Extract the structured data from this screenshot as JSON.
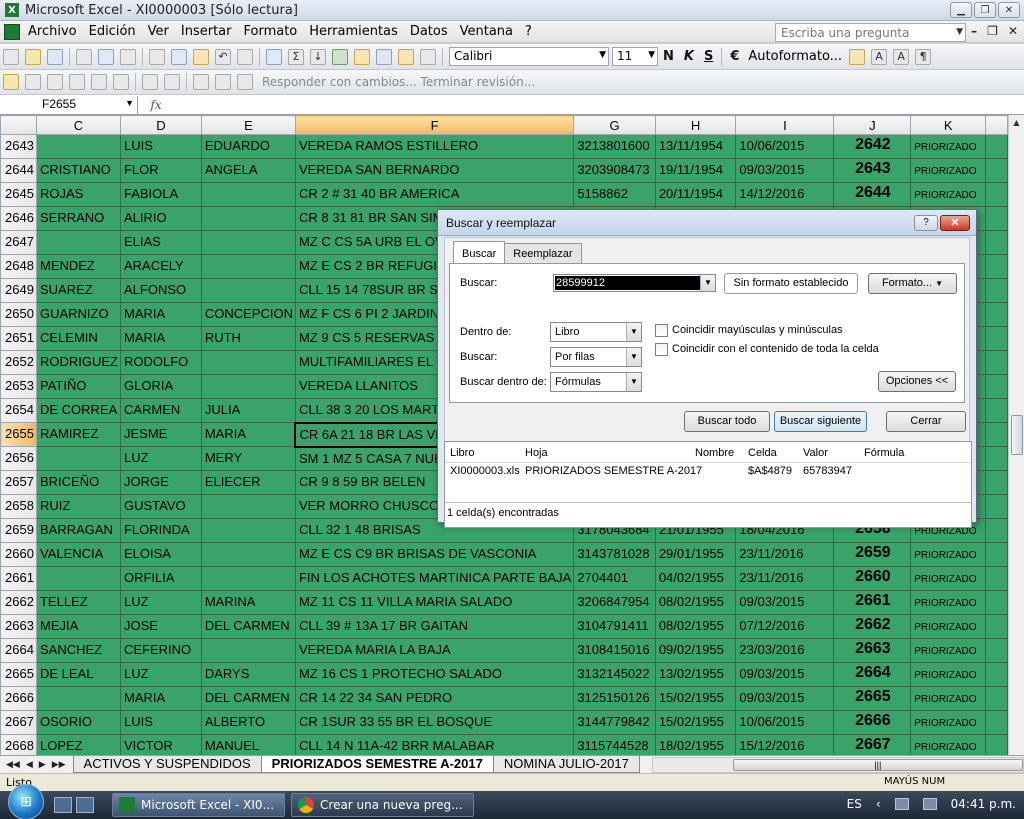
{
  "window": {
    "title": "Microsoft Excel - XI0000003  [Sólo lectura]"
  },
  "menu": {
    "items": [
      "Archivo",
      "Edición",
      "Ver",
      "Insertar",
      "Formato",
      "Herramientas",
      "Datos",
      "Ventana",
      "?"
    ],
    "ask_placeholder": "Escriba una pregunta"
  },
  "toolbar": {
    "font_name": "Calibri",
    "font_size": "11",
    "bold": "N",
    "italic": "K",
    "underline": "S",
    "currency": "€",
    "autoformat": "Autoformato...",
    "sigma": "Σ",
    "review_text": "Responder con cambios... Terminar revisión..."
  },
  "formula_bar": {
    "name_box": "F2655",
    "fx": "fx",
    "content": ""
  },
  "sheet": {
    "columns": [
      "C",
      "D",
      "E",
      "F",
      "G",
      "H",
      "I",
      "J",
      "K"
    ],
    "selected_column": "F",
    "selected_row": "2655",
    "rows": [
      {
        "n": "2643",
        "c": "",
        "d": "LUIS",
        "e": "EDUARDO",
        "f": "VEREDA RAMOS ESTILLERO",
        "g": "3213801600",
        "h": "13/11/1954",
        "i": "10/06/2015",
        "j": "2642",
        "k": "PRIORIZADO"
      },
      {
        "n": "2644",
        "c": "CRISTIANO",
        "d": "FLOR",
        "e": "ANGELA",
        "f": "VEREDA SAN BERNARDO",
        "g": "3203908473",
        "h": "19/11/1954",
        "i": "09/03/2015",
        "j": "2643",
        "k": "PRIORIZADO"
      },
      {
        "n": "2645",
        "c": "ROJAS",
        "d": "FABIOLA",
        "e": "",
        "f": "CR 2 # 31 40 BR AMERICA",
        "g": "5158862",
        "h": "20/11/1954",
        "i": "14/12/2016",
        "j": "2644",
        "k": "PRIORIZADO"
      },
      {
        "n": "2646",
        "c": "SERRANO",
        "d": "ALIRIO",
        "e": "",
        "f": "CR 8  31 81 BR SAN SIMON",
        "g": "",
        "h": "",
        "i": "",
        "j": "",
        "k": ""
      },
      {
        "n": "2647",
        "c": "",
        "d": "ELIAS",
        "e": "",
        "f": "MZ C CS 5A URB EL OVIEDO",
        "g": "",
        "h": "",
        "i": "",
        "j": "",
        "k": ""
      },
      {
        "n": "2648",
        "c": "MENDEZ",
        "d": "ARACELY",
        "e": "",
        "f": "MZ E CS 2 BR REFUGIO",
        "g": "",
        "h": "",
        "i": "",
        "j": "",
        "k": ""
      },
      {
        "n": "2649",
        "c": "SUAREZ",
        "d": "ALFONSO",
        "e": "",
        "f": "CLL 15  14 78SUR BR SAN",
        "g": "",
        "h": "",
        "i": "",
        "j": "",
        "k": ""
      },
      {
        "n": "2650",
        "c": "GUARNIZO",
        "d": "MARIA",
        "e": "CONCEPCION",
        "f": "MZ F CS 6 PI 2 JARDIN",
        "g": "",
        "h": "",
        "i": "",
        "j": "",
        "k": ""
      },
      {
        "n": "2651",
        "c": "CELEMIN",
        "d": "MARIA",
        "e": "RUTH",
        "f": "MZ 9 CS 5 RESERVAS DE SA",
        "g": "",
        "h": "",
        "i": "",
        "j": "",
        "k": ""
      },
      {
        "n": "2652",
        "c": "RODRIGUEZ",
        "d": "RODOLFO",
        "e": "",
        "f": "MULTIFAMILIARES EL TEJAR",
        "g": "",
        "h": "",
        "i": "",
        "j": "",
        "k": ""
      },
      {
        "n": "2653",
        "c": "PATIÑO",
        "d": "GLORIA",
        "e": "",
        "f": "VEREDA LLANITOS",
        "g": "",
        "h": "",
        "i": "",
        "j": "",
        "k": ""
      },
      {
        "n": "2654",
        "c": "DE CORREA",
        "d": "CARMEN",
        "e": "JULIA",
        "f": "CLL 38  3 20 LOS MARTIRES",
        "g": "",
        "h": "",
        "i": "",
        "j": "",
        "k": ""
      },
      {
        "n": "2655",
        "c": "RAMIREZ",
        "d": "JESME",
        "e": "MARIA",
        "f": "CR 6A  21 18 BR LAS VEGAS",
        "g": "",
        "h": "",
        "i": "",
        "j": "",
        "k": ""
      },
      {
        "n": "2656",
        "c": "",
        "d": "LUZ",
        "e": "MERY",
        "f": "SM 1 MZ 5 CASA 7 NUEVA",
        "g": "",
        "h": "",
        "i": "",
        "j": "",
        "k": ""
      },
      {
        "n": "2657",
        "c": "BRICEÑO",
        "d": "JORGE",
        "e": "ELIECER",
        "f": "CR 9 8 59 BR BELEN",
        "g": "",
        "h": "",
        "i": "",
        "j": "",
        "k": ""
      },
      {
        "n": "2658",
        "c": "RUIZ",
        "d": "GUSTAVO",
        "e": "",
        "f": "VER MORRO CHUSCO",
        "g": "",
        "h": "",
        "i": "",
        "j": "",
        "k": ""
      },
      {
        "n": "2659",
        "c": "BARRAGAN",
        "d": "FLORINDA",
        "e": "",
        "f": "CLL 32  1 48 BRISAS",
        "g": "3178043684",
        "h": "21/01/1955",
        "i": "18/04/2016",
        "j": "2658",
        "k": "PRIORIZADO"
      },
      {
        "n": "2660",
        "c": "VALENCIA",
        "d": "ELOISA",
        "e": "",
        "f": "MZ E CS C9 BR BRISAS DE VASCONIA",
        "g": "3143781028",
        "h": "29/01/1955",
        "i": "23/11/2016",
        "j": "2659",
        "k": "PRIORIZADO"
      },
      {
        "n": "2661",
        "c": "",
        "d": "ORFILIA",
        "e": "",
        "f": "FIN LOS ACHOTES MARTINICA PARTE BAJA",
        "g": "2704401",
        "h": "04/02/1955",
        "i": "23/11/2016",
        "j": "2660",
        "k": "PRIORIZADO"
      },
      {
        "n": "2662",
        "c": "TELLEZ",
        "d": "LUZ",
        "e": "MARINA",
        "f": "MZ 11 CS 11 VILLA MARIA SALADO",
        "g": "3206847954",
        "h": "08/02/1955",
        "i": "09/03/2015",
        "j": "2661",
        "k": "PRIORIZADO"
      },
      {
        "n": "2663",
        "c": "MEJIA",
        "d": "JOSE",
        "e": "DEL CARMEN",
        "f": "CLL 39 # 13A 17 BR GAITAN",
        "g": "3104791411",
        "h": "08/02/1955",
        "i": "07/12/2016",
        "j": "2662",
        "k": "PRIORIZADO"
      },
      {
        "n": "2664",
        "c": "SANCHEZ",
        "d": "CEFERINO",
        "e": "",
        "f": "VEREDA MARIA LA BAJA",
        "g": "3108415016",
        "h": "09/02/1955",
        "i": "23/03/2016",
        "j": "2663",
        "k": "PRIORIZADO"
      },
      {
        "n": "2665",
        "c": "DE LEAL",
        "d": "LUZ",
        "e": "DARYS",
        "f": "MZ 16 CS 1 PROTECHO SALADO",
        "g": "3132145022",
        "h": "13/02/1955",
        "i": "09/03/2015",
        "j": "2664",
        "k": "PRIORIZADO"
      },
      {
        "n": "2666",
        "c": "",
        "d": "MARIA",
        "e": "DEL CARMEN",
        "f": "CR 14  22 34 SAN PEDRO",
        "g": "3125150126",
        "h": "15/02/1955",
        "i": "09/03/2015",
        "j": "2665",
        "k": "PRIORIZADO"
      },
      {
        "n": "2667",
        "c": "OSORIO",
        "d": "LUIS",
        "e": "ALBERTO",
        "f": "CR 1SUR  33 55 BR EL BOSQUE",
        "g": "3144779842",
        "h": "15/02/1955",
        "i": "10/06/2015",
        "j": "2666",
        "k": "PRIORIZADO"
      },
      {
        "n": "2668",
        "c": "LOPEZ",
        "d": "VICTOR",
        "e": "MANUEL",
        "f": "CLL 14 N 11A-42 BRR MALABAR",
        "g": "3115744528",
        "h": "18/02/1955",
        "i": "15/12/2016",
        "j": "2667",
        "k": "PRIORIZADO"
      }
    ],
    "tabs": [
      "ACTIVOS Y SUSPENDIDOS",
      "PRIORIZADOS SEMESTRE A-2017",
      "NOMINA JULIO-2017"
    ],
    "active_tab": "PRIORIZADOS SEMESTRE A-2017"
  },
  "status": {
    "text": "Listo",
    "caps": "MAYÚS  NUM"
  },
  "dialog": {
    "title": "Buscar y reemplazar",
    "tabs": [
      "Buscar",
      "Reemplazar"
    ],
    "find_label": "Buscar:",
    "find_value": "28599912",
    "no_format": "Sin formato establecido",
    "format_button": "Formato...",
    "within_label": "Dentro de:",
    "within_value": "Libro",
    "search_label": "Buscar:",
    "search_value": "Por filas",
    "lookin_label": "Buscar dentro de:",
    "lookin_value": "Fórmulas",
    "match_case": "Coincidir mayúsculas y minúsculas",
    "match_entire": "Coincidir con el contenido de toda la celda",
    "options_button": "Opciones <<",
    "find_all": "Buscar todo",
    "find_next": "Buscar siguiente",
    "close": "Cerrar",
    "result_headers": [
      "Libro",
      "Hoja",
      "Nombre",
      "Celda",
      "Valor",
      "Fórmula"
    ],
    "result_row": {
      "libro": "XI0000003.xls",
      "hoja": "PRIORIZADOS SEMESTRE A-2017",
      "nombre": "",
      "celda": "$A$4879",
      "valor": "65783947",
      "formula": ""
    },
    "result_status": "1 celda(s) encontradas",
    "help": "?",
    "close_x": "✕"
  },
  "taskbar": {
    "items": [
      "Microsoft Excel - XI0...",
      "Crear una nueva preg..."
    ],
    "lang": "ES",
    "time": "04:41 p.m."
  }
}
